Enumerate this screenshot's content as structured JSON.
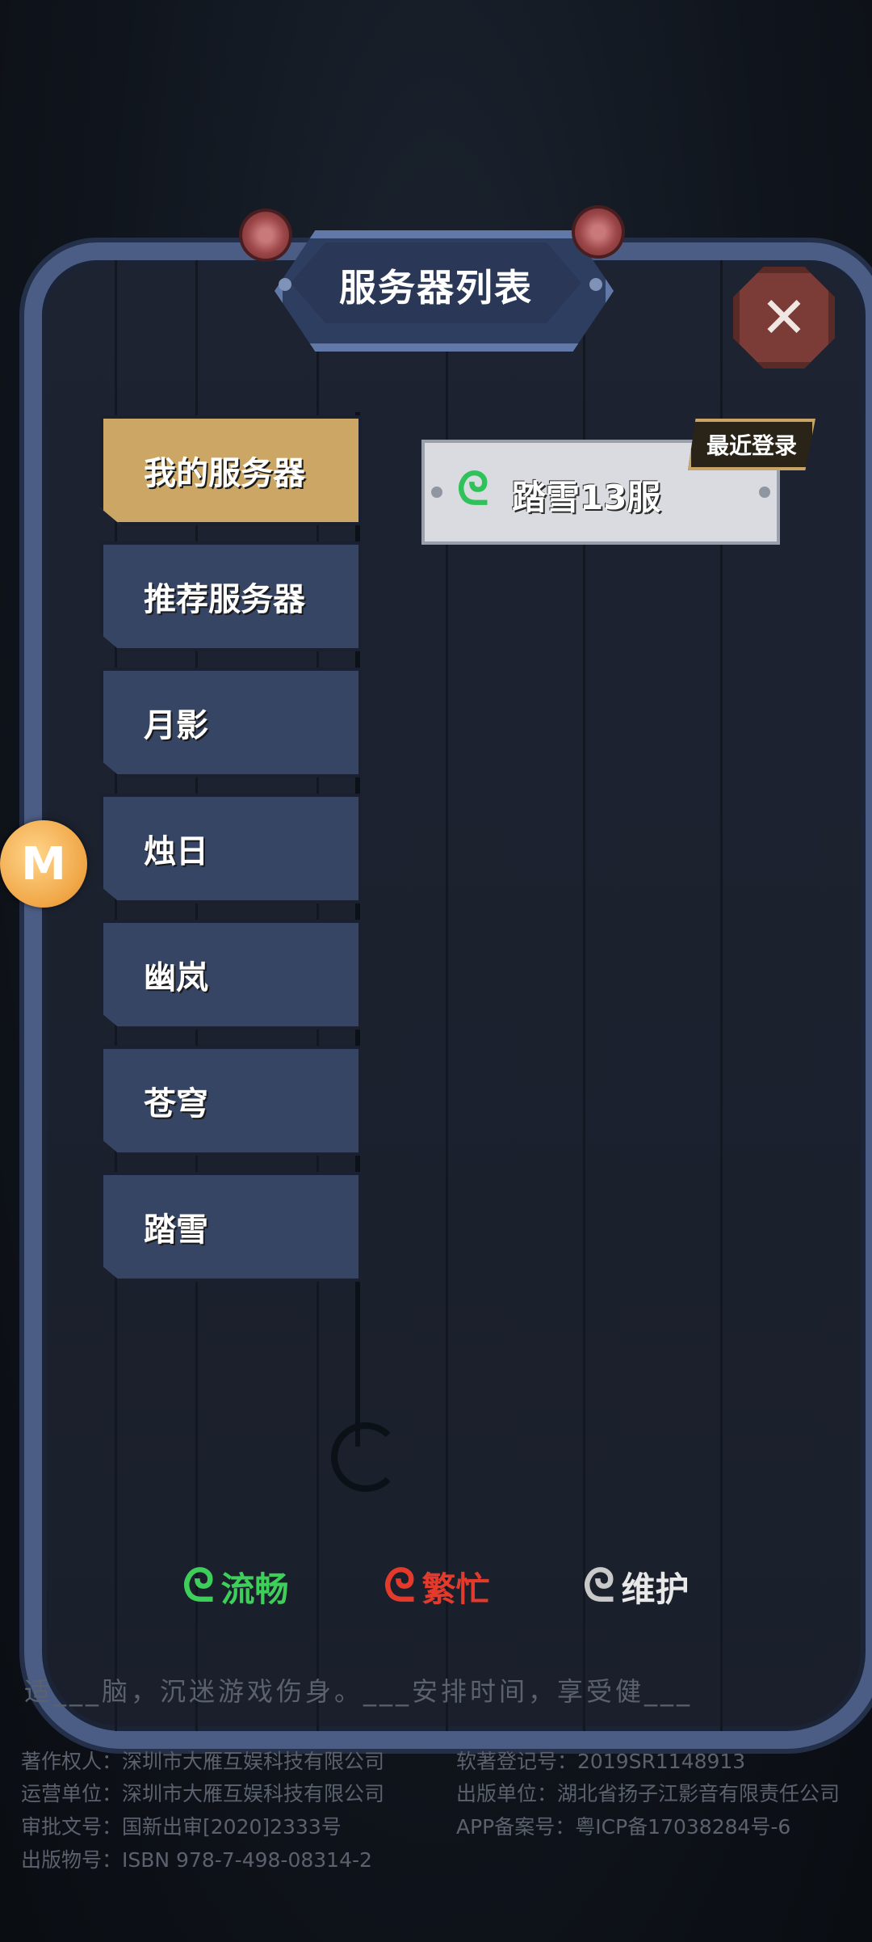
{
  "header": {
    "title": "服务器列表"
  },
  "tabs": [
    {
      "label": "我的服务器",
      "active": true
    },
    {
      "label": "推荐服务器",
      "active": false
    },
    {
      "label": "月影",
      "active": false
    },
    {
      "label": "烛日",
      "active": false
    },
    {
      "label": "幽岚",
      "active": false
    },
    {
      "label": "苍穹",
      "active": false
    },
    {
      "label": "踏雪",
      "active": false
    }
  ],
  "server_card": {
    "name": "踏雪13服",
    "badge": "最近登录",
    "status_color": "#2fc15a"
  },
  "legend": [
    {
      "label": "流畅",
      "color": "#3ecf5a",
      "icon": "status-smooth-icon"
    },
    {
      "label": "繁忙",
      "color": "#e33a2c",
      "icon": "status-busy-icon"
    },
    {
      "label": "维护",
      "color": "#c9c9c9",
      "icon": "status-maintenance-icon"
    }
  ],
  "notice": "适___脑，沉迷游戏伤身。___安排时间，享受健___",
  "copyright": {
    "left": [
      "著作权人：深圳市大雁互娱科技有限公司",
      "运营单位：深圳市大雁互娱科技有限公司",
      "审批文号：国新出审[2020]2333号",
      "出版物号：ISBN 978-7-498-08314-2"
    ],
    "right": [
      "软著登记号：2019SR1148913",
      "出版单位：湖北省扬子江影音有限责任公司",
      "APP备案号：粤ICP备17038284号-6"
    ]
  },
  "floating_button": {
    "label": "M"
  }
}
